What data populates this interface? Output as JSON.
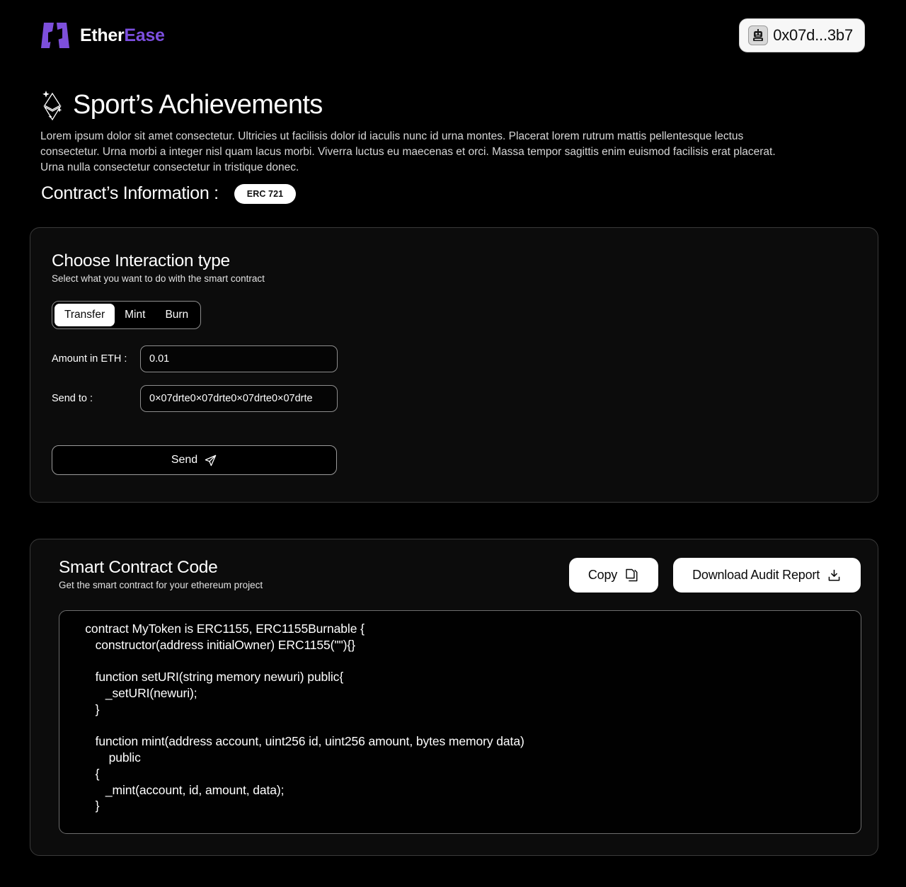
{
  "header": {
    "brand_primary": "Ether",
    "brand_secondary": "Ease",
    "logo_icon": "ether-ease-logo",
    "wallet": {
      "address": "0x07d...3b7",
      "avatar_icon": "robot-avatar-icon"
    }
  },
  "hero": {
    "title_icon": "ethereum-diamond-sparkle-icon",
    "title": "Sport’s Achievements",
    "description": "Lorem ipsum dolor sit amet consectetur. Ultricies ut facilisis dolor id iaculis nunc id urna montes. Placerat lorem rutrum mattis pellentesque lectus consectetur. Urna morbi a integer nisl quam lacus morbi. Viverra luctus eu maecenas et orci. Massa tempor sagittis enim euismod facilisis erat placerat. Urna nulla consectetur consectetur in tristique donec."
  },
  "contract_info": {
    "title": "Contract’s Information :",
    "standard_badge": "ERC 721"
  },
  "interaction": {
    "title": "Choose Interaction type",
    "subtitle": "Select what you want to do with the smart contract",
    "tabs": [
      {
        "label": "Transfer",
        "selected": true
      },
      {
        "label": "Mint",
        "selected": false
      },
      {
        "label": "Burn",
        "selected": false
      }
    ],
    "fields": [
      {
        "label": "Amount in ETH :",
        "value": "0.01",
        "placeholder": "0.01"
      },
      {
        "label": "Send to :",
        "value": "0×07drte0×07drte0×07drte0×07drte",
        "placeholder": "0×07drte0×07drte0×07drte0×07drte"
      }
    ],
    "send_button": {
      "label": "Send",
      "icon": "paper-plane-icon"
    }
  },
  "smart_contract": {
    "title": "Smart Contract Code",
    "subtitle": "Get the smart contract for your ethereum project",
    "copy_button": {
      "label": "Copy",
      "icon": "copy-icon"
    },
    "download_button": {
      "label": "Download Audit Report",
      "icon": "download-icon"
    },
    "code": "   contract MyToken is ERC1155, ERC1155Burnable {\n      constructor(address initialOwner) ERC1155(\"\"){}\n\n      function setURI(string memory newuri) public{\n         _setURI(newuri);\n      }\n\n      function mint(address account, uint256 id, uint256 amount, bytes memory data)\n          public\n      {\n         _mint(account, id, amount, data);\n      }"
  },
  "colors": {
    "background": "#000000",
    "card_background": "#0c0c0c",
    "card_border": "#3a3a3a",
    "brand_accent": "#7c4fe0",
    "text_primary": "#ffffff",
    "accent_on_white": "#0a0a0a"
  }
}
